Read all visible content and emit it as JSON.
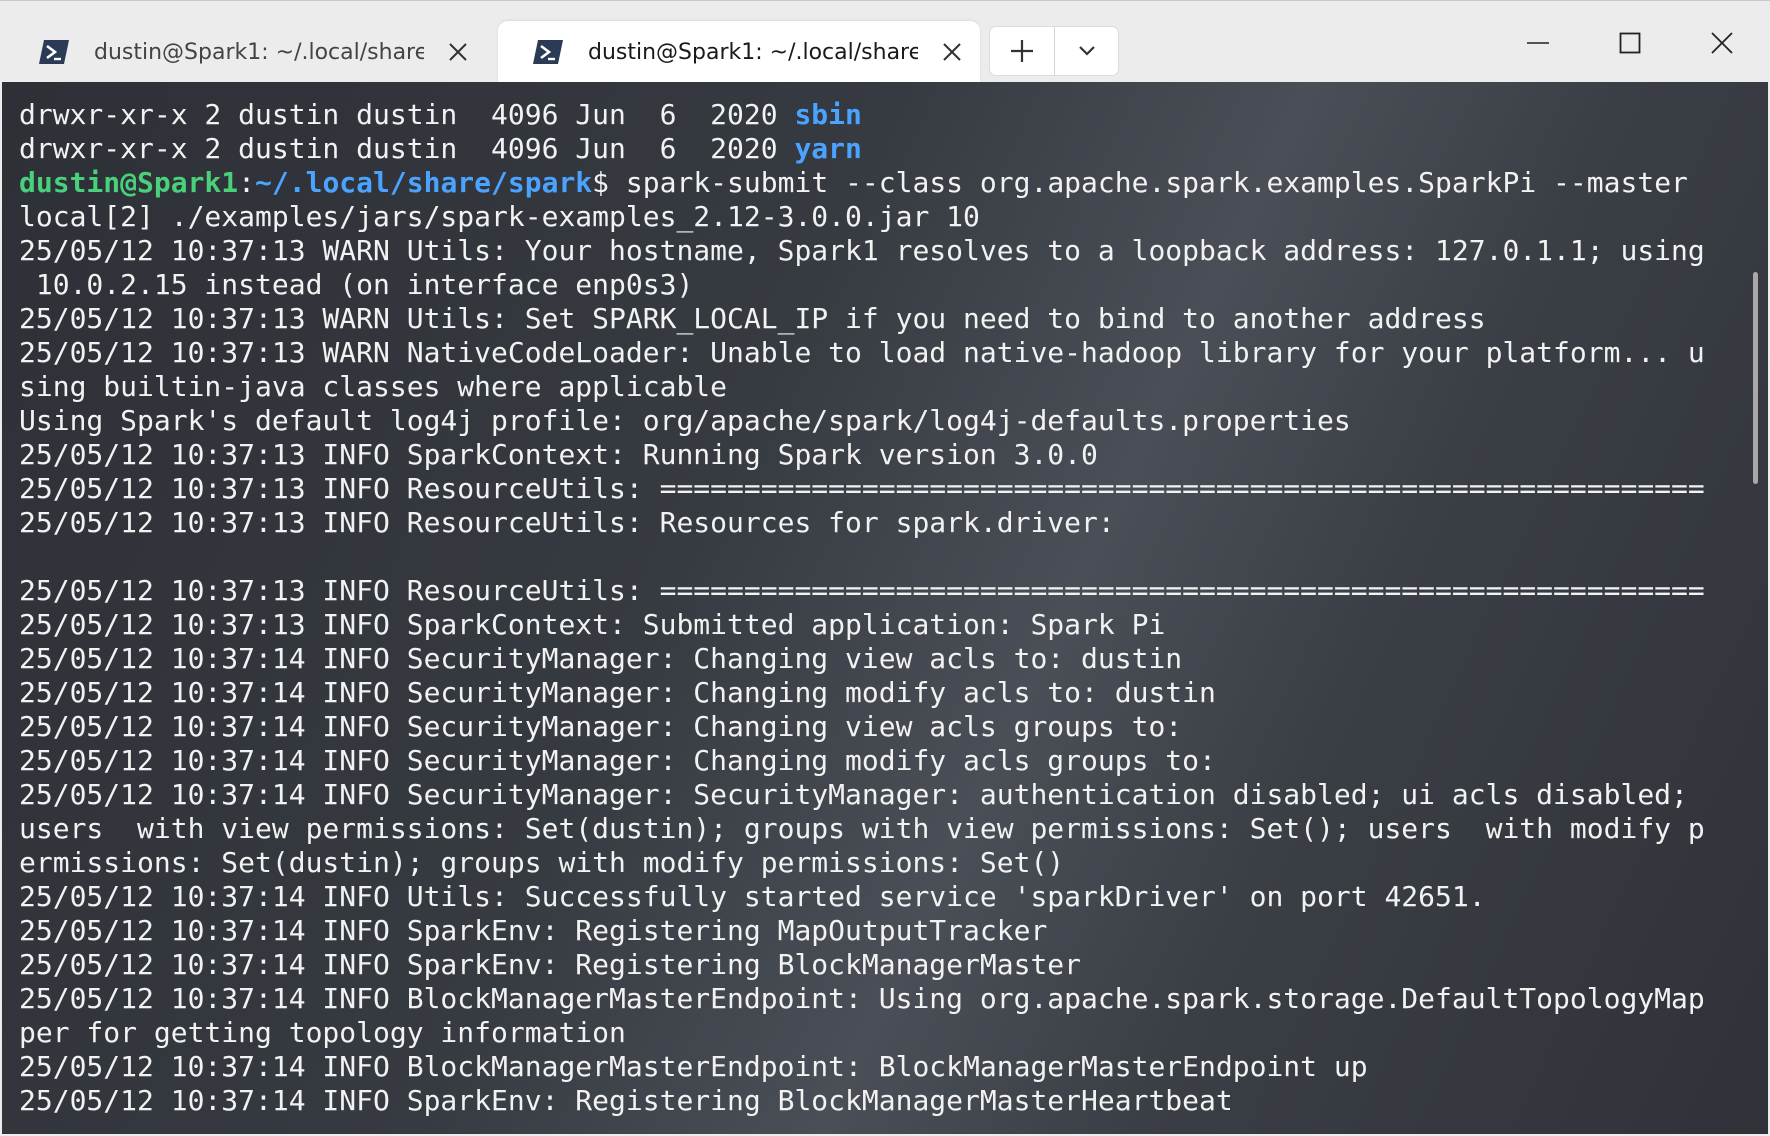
{
  "tabs": [
    {
      "label": "dustin@Spark1: ~/.local/share/",
      "icon": "powershell-icon",
      "active": false
    },
    {
      "label": "dustin@Spark1: ~/.local/share,",
      "icon": "powershell-icon",
      "active": true
    }
  ],
  "colors": {
    "terminal_bg": "#2d3036",
    "text": "#f2f2f2",
    "dir_blue": "#4aa3ff",
    "prompt_green": "#49d07b"
  },
  "terminal": {
    "lines": [
      {
        "segments": [
          {
            "text": "drwxr-xr-x 2 dustin dustin  4096 Jun  6  2020 "
          },
          {
            "text": "sbin",
            "style": "blue"
          }
        ]
      },
      {
        "segments": [
          {
            "text": "drwxr-xr-x 2 dustin dustin  4096 Jun  6  2020 "
          },
          {
            "text": "yarn",
            "style": "blue"
          }
        ]
      },
      {
        "segments": [
          {
            "text": "dustin@Spark1",
            "style": "green"
          },
          {
            "text": ":"
          },
          {
            "text": "~/.local/share/spark",
            "style": "path"
          },
          {
            "text": "$ spark-submit --class org.apache.spark.examples.SparkPi --master"
          }
        ]
      },
      {
        "segments": [
          {
            "text": "local[2] ./examples/jars/spark-examples_2.12-3.0.0.jar 10"
          }
        ]
      },
      {
        "segments": [
          {
            "text": "25/05/12 10:37:13 WARN Utils: Your hostname, Spark1 resolves to a loopback address: 127.0.1.1; using"
          }
        ]
      },
      {
        "segments": [
          {
            "text": " 10.0.2.15 instead (on interface enp0s3)"
          }
        ]
      },
      {
        "segments": [
          {
            "text": "25/05/12 10:37:13 WARN Utils: Set SPARK_LOCAL_IP if you need to bind to another address"
          }
        ]
      },
      {
        "segments": [
          {
            "text": "25/05/12 10:37:13 WARN NativeCodeLoader: Unable to load native-hadoop library for your platform... u"
          }
        ]
      },
      {
        "segments": [
          {
            "text": "sing builtin-java classes where applicable"
          }
        ]
      },
      {
        "segments": [
          {
            "text": "Using Spark's default log4j profile: org/apache/spark/log4j-defaults.properties"
          }
        ]
      },
      {
        "segments": [
          {
            "text": "25/05/12 10:37:13 INFO SparkContext: Running Spark version 3.0.0"
          }
        ]
      },
      {
        "segments": [
          {
            "text": "25/05/12 10:37:13 INFO ResourceUtils: =============================================================="
          }
        ]
      },
      {
        "segments": [
          {
            "text": "25/05/12 10:37:13 INFO ResourceUtils: Resources for spark.driver:"
          }
        ]
      },
      {
        "segments": [
          {
            "text": ""
          }
        ]
      },
      {
        "segments": [
          {
            "text": "25/05/12 10:37:13 INFO ResourceUtils: =============================================================="
          }
        ]
      },
      {
        "segments": [
          {
            "text": "25/05/12 10:37:13 INFO SparkContext: Submitted application: Spark Pi"
          }
        ]
      },
      {
        "segments": [
          {
            "text": "25/05/12 10:37:14 INFO SecurityManager: Changing view acls to: dustin"
          }
        ]
      },
      {
        "segments": [
          {
            "text": "25/05/12 10:37:14 INFO SecurityManager: Changing modify acls to: dustin"
          }
        ]
      },
      {
        "segments": [
          {
            "text": "25/05/12 10:37:14 INFO SecurityManager: Changing view acls groups to:"
          }
        ]
      },
      {
        "segments": [
          {
            "text": "25/05/12 10:37:14 INFO SecurityManager: Changing modify acls groups to:"
          }
        ]
      },
      {
        "segments": [
          {
            "text": "25/05/12 10:37:14 INFO SecurityManager: SecurityManager: authentication disabled; ui acls disabled;"
          }
        ]
      },
      {
        "segments": [
          {
            "text": "users  with view permissions: Set(dustin); groups with view permissions: Set(); users  with modify p"
          }
        ]
      },
      {
        "segments": [
          {
            "text": "ermissions: Set(dustin); groups with modify permissions: Set()"
          }
        ]
      },
      {
        "segments": [
          {
            "text": "25/05/12 10:37:14 INFO Utils: Successfully started service 'sparkDriver' on port 42651."
          }
        ]
      },
      {
        "segments": [
          {
            "text": "25/05/12 10:37:14 INFO SparkEnv: Registering MapOutputTracker"
          }
        ]
      },
      {
        "segments": [
          {
            "text": "25/05/12 10:37:14 INFO SparkEnv: Registering BlockManagerMaster"
          }
        ]
      },
      {
        "segments": [
          {
            "text": "25/05/12 10:37:14 INFO BlockManagerMasterEndpoint: Using org.apache.spark.storage.DefaultTopologyMap"
          }
        ]
      },
      {
        "segments": [
          {
            "text": "per for getting topology information"
          }
        ]
      },
      {
        "segments": [
          {
            "text": "25/05/12 10:37:14 INFO BlockManagerMasterEndpoint: BlockManagerMasterEndpoint up"
          }
        ]
      },
      {
        "segments": [
          {
            "text": "25/05/12 10:37:14 INFO SparkEnv: Registering BlockManagerMasterHeartbeat"
          }
        ]
      }
    ]
  }
}
